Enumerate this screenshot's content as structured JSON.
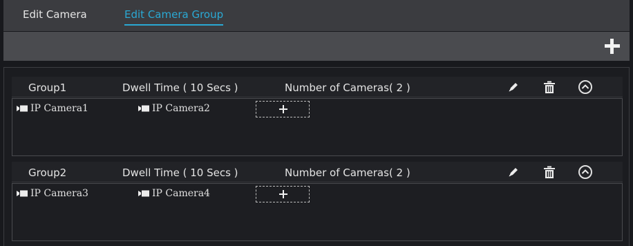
{
  "tabs": {
    "edit_camera": "Edit Camera",
    "edit_camera_group": "Edit Camera Group"
  },
  "toolbar": {
    "add_icon": "plus-icon"
  },
  "groups": [
    {
      "name": "Group1",
      "dwell_time": "Dwell Time ( 10 Secs )",
      "camera_count": "Number of Cameras( 2 )",
      "cameras": [
        "IP Camera1",
        "IP Camera2"
      ]
    },
    {
      "name": "Group2",
      "dwell_time": "Dwell Time ( 10 Secs )",
      "camera_count": "Number of Cameras( 2 )",
      "cameras": [
        "IP Camera3",
        "IP Camera4"
      ]
    }
  ],
  "icons": {
    "edit": "pencil-icon",
    "delete": "trash-icon",
    "collapse": "chevron-up-circle-icon",
    "camera": "video-camera-icon"
  },
  "colors": {
    "accent": "#2aa9d4",
    "background": "#18191d",
    "tab_bar": "#3b3c40",
    "toolbar": "#4a4b4f"
  }
}
